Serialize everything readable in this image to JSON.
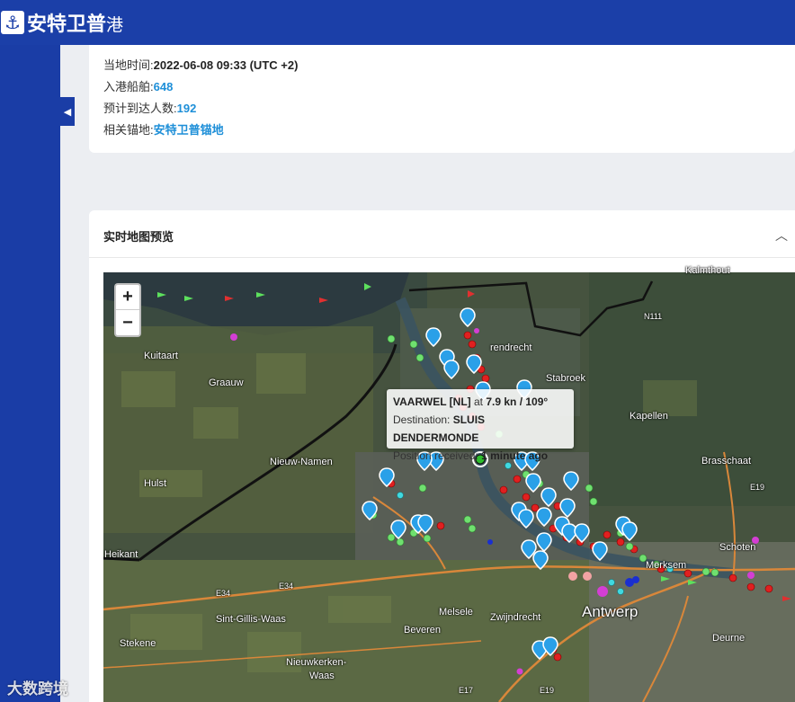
{
  "header": {
    "brand": "安特卫普",
    "brand_suffix": "港",
    "logo_icon": "anchor-icon"
  },
  "info": {
    "local_time_label": "当地时间:",
    "local_time_value": "2022-06-08 09:33 (UTC +2)",
    "inbound_label": "入港船舶:",
    "inbound_value": "648",
    "expected_label": "预计到达人数:",
    "expected_value": "192",
    "anchorage_label": "相关锚地:",
    "anchorage_value": "安特卫普锚地"
  },
  "map_card": {
    "title": "实时地图预览",
    "zoom_in": "+",
    "zoom_out": "−"
  },
  "places": {
    "kalmthout": "Kalmthout",
    "kuitaart": "Kuitaart",
    "graauw": "Graauw",
    "zandvliet": "rendrecht",
    "stabroek": "Stabroek",
    "kapellen": "Kapellen",
    "nieuw_namen": "Nieuw-Namen",
    "hulst": "Hulst",
    "brasschaat": "Brasschaat",
    "heikant": "Heikant",
    "schoten": "Schoten",
    "merksem": "Merksem",
    "antwerp": "Antwerp",
    "sint_gillis": "Sint-Gillis-Waas",
    "melsele": "Melsele",
    "zwijndrecht": "Zwijndrecht",
    "stekene": "Stekene",
    "beveren": "Beveren",
    "deurne": "Deurne",
    "nieuwkerken": "Nieuwkerken-",
    "waas": "Waas",
    "n111": "N111",
    "e34a": "E34",
    "e34b": "E34",
    "e19a": "E19",
    "e17": "E17",
    "e19b": "E19"
  },
  "tooltip": {
    "vessel": "VAARWEL [NL]",
    "at": " at ",
    "speed": "7.9 kn / 109°",
    "dest_label": "Destination: ",
    "dest_value": "SLUIS DENDERMONDE",
    "pos_label": "Position received: ",
    "pos_value": "1 minute ago"
  },
  "watermark": "大数跨境",
  "colors": {
    "primary": "#1b3fa8",
    "link": "#1e8fd8",
    "marker_red": "#e02020",
    "marker_green": "#6fe06f",
    "marker_blue": "#2aa0e8"
  }
}
